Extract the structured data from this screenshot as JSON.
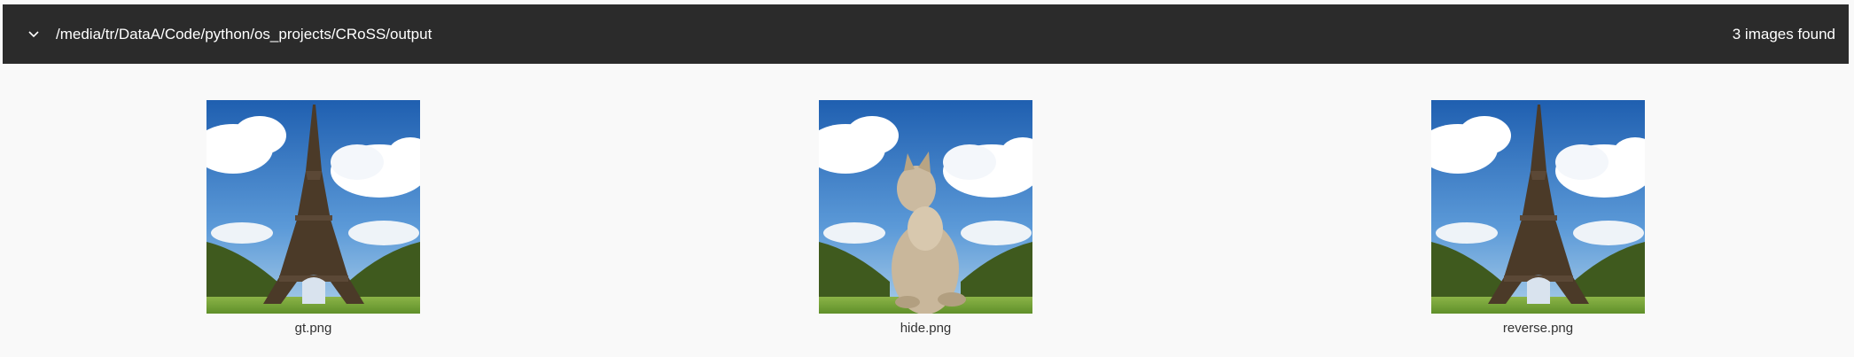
{
  "header": {
    "path": "/media/tr/DataA/Code/python/os_projects/CRoSS/output",
    "count_label": "3 images found",
    "collapse_icon": "chevron-down-icon"
  },
  "gallery": {
    "images": [
      {
        "filename": "gt.png",
        "subject": "eiffel-tower"
      },
      {
        "filename": "hide.png",
        "subject": "cat"
      },
      {
        "filename": "reverse.png",
        "subject": "eiffel-tower"
      }
    ]
  },
  "colors": {
    "header_bg": "#2b2b2b",
    "page_bg": "#f9f9f9",
    "sky": "#2d74c4",
    "grass": "#7fa83a"
  }
}
